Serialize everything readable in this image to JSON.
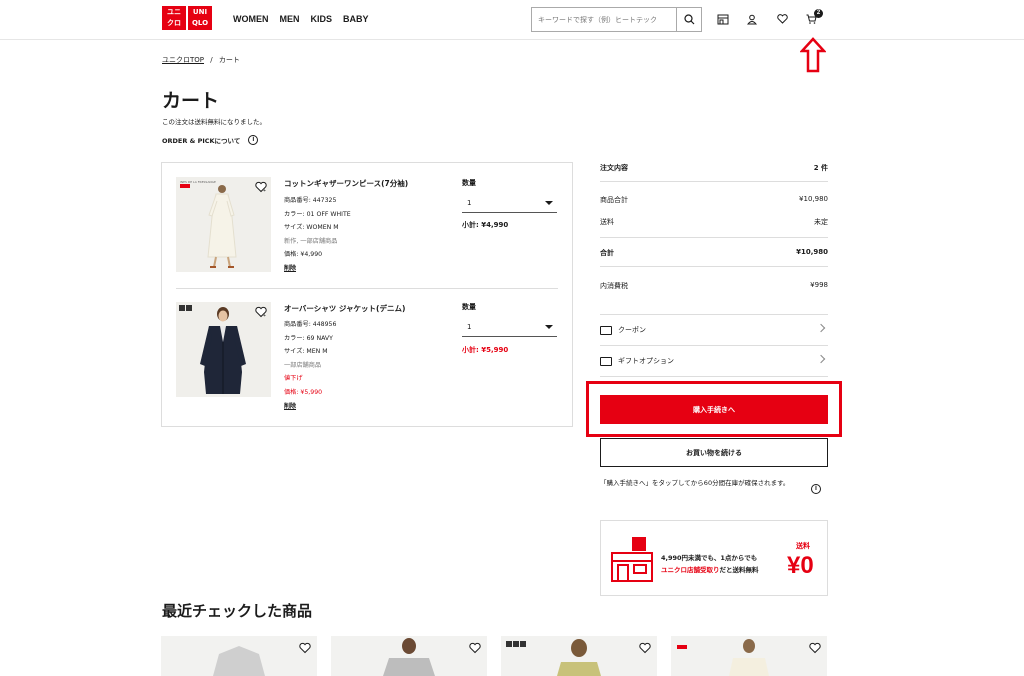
{
  "header": {
    "logo_top": "ユニ",
    "logo_mid": "クロ",
    "logo_top2": "UNI",
    "logo_mid2": "QLO",
    "nav": [
      "WOMEN",
      "MEN",
      "KIDS",
      "BABY"
    ],
    "search_placeholder": "キーワードで探す（例）ヒートテック",
    "cart_count": "2"
  },
  "breadcrumb": {
    "home": "ユニクロTOP",
    "sep": "/",
    "current": "カート"
  },
  "page_title": "カート",
  "free_shipping_note": "この注文は送料無料になりました。",
  "order_pick": "ORDER & PICKについて",
  "items": [
    {
      "name": "コットンギャザーワンピース(7分袖)",
      "product_no": "商品番号: 447325",
      "color": "カラー: 01 OFF WHITE",
      "size": "サイズ: WOMEN M",
      "note": "新作, 一部店舗商品",
      "price": "価格: ¥4,990",
      "delete": "削除",
      "qty_label": "数量",
      "qty": "1",
      "subtotal": "小計: ¥4,990"
    },
    {
      "name": "オーバーシャツ ジャケット(デニム)",
      "product_no": "商品番号: 448956",
      "color": "カラー: 69 NAVY",
      "size": "サイズ: MEN M",
      "note": "一部店舗商品",
      "discount": "値下げ",
      "price": "価格: ¥5,990",
      "delete": "削除",
      "qty_label": "数量",
      "qty": "1",
      "subtotal": "小計: ¥5,990"
    }
  ],
  "summary": {
    "order_label": "注文内容",
    "order_count": "2 件",
    "goods_total_label": "商品合計",
    "goods_total": "¥10,980",
    "shipping_label": "送料",
    "shipping": "未定",
    "total_label": "合計",
    "total": "¥10,980",
    "tax_label": "内消費税",
    "tax": "¥998",
    "coupon": "クーポン",
    "gift": "ギフトオプション",
    "buy_button": "購入手続きへ",
    "continue_button": "お買い物を続ける",
    "reserve_note": "「購入手続きへ」をタップしてから60分間在庫が確保されます。"
  },
  "banner": {
    "line1": "4,990円未満でも、1点からでも",
    "line2_red": "ユニクロ店舗受取り",
    "line2_rest": "だと送料無料",
    "soryo": "送料",
    "zero": "¥0"
  },
  "recent_title": "最近チェックした商品",
  "colors": {
    "brand_red": "#e60012",
    "text": "#1b1b1b"
  }
}
